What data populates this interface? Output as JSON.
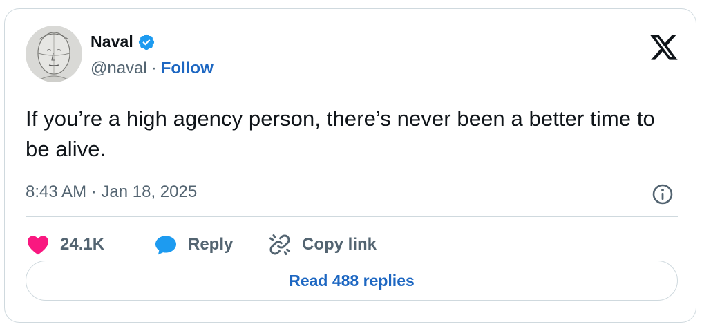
{
  "author": {
    "name": "Naval",
    "handle": "@naval",
    "separator": "·",
    "follow_label": "Follow",
    "verified": true
  },
  "tweet": {
    "text": "If you’re a high agency person, there’s never been a better time to be alive.",
    "timestamp": "8:43 AM · Jan 18, 2025"
  },
  "actions": {
    "like_count": "24.1K",
    "reply_label": "Reply",
    "copy_link_label": "Copy link"
  },
  "read_replies_label": "Read 488 replies",
  "colors": {
    "accent": "#1d67c2",
    "verified_blue": "#1d9bf0",
    "like_pink": "#f91880",
    "reply_blue": "#1d9bf0",
    "muted": "#536471",
    "border": "#cfd9de"
  },
  "icons": {
    "logo": "x-logo-icon",
    "verified": "verified-badge-icon",
    "info": "info-icon",
    "like": "heart-icon",
    "reply": "speech-bubble-icon",
    "copy_link": "link-icon"
  }
}
